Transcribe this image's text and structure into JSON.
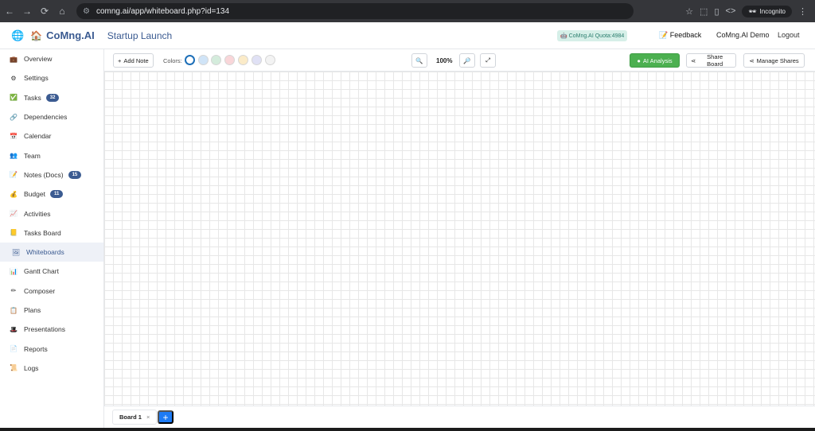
{
  "browser": {
    "url": "comng.ai/app/whiteboard.php?id=134",
    "mode_label": "Incognito"
  },
  "header": {
    "brand": "CoMng.AI",
    "project_title": "Startup Launch",
    "quota_label": "CoMng.AI Quota:4984",
    "feedback_label": "Feedback",
    "user_label": "CoMng.AI Demo",
    "logout_label": "Logout"
  },
  "sidebar": {
    "items": [
      {
        "label": "Overview",
        "icon": "briefcase-icon",
        "glyph": "💼"
      },
      {
        "label": "Settings",
        "icon": "gear-icon",
        "glyph": "⚙"
      },
      {
        "label": "Tasks",
        "icon": "checkbox-icon",
        "glyph": "✅",
        "badge": "32"
      },
      {
        "label": "Dependencies",
        "icon": "link-icon",
        "glyph": "🔗"
      },
      {
        "label": "Calendar",
        "icon": "calendar-icon",
        "glyph": "📅"
      },
      {
        "label": "Team",
        "icon": "people-icon",
        "glyph": "👥"
      },
      {
        "label": "Notes (Docs)",
        "icon": "notes-icon",
        "glyph": "📝",
        "badge": "15"
      },
      {
        "label": "Budget",
        "icon": "money-bag-icon",
        "glyph": "💰",
        "badge": "11"
      },
      {
        "label": "Activities",
        "icon": "chart-up-icon",
        "glyph": "📈"
      },
      {
        "label": "Tasks Board",
        "icon": "sticky-note-icon",
        "glyph": "📒"
      },
      {
        "label": "Whiteboards",
        "icon": "picture-icon",
        "glyph": "🖼",
        "active": true
      },
      {
        "label": "Gantt Chart",
        "icon": "bar-chart-icon",
        "glyph": "📊"
      },
      {
        "label": "Composer",
        "icon": "pencil-icon",
        "glyph": "✏"
      },
      {
        "label": "Plans",
        "icon": "clipboard-icon",
        "glyph": "📋"
      },
      {
        "label": "Presentations",
        "icon": "presentation-icon",
        "glyph": "🎩"
      },
      {
        "label": "Reports",
        "icon": "report-icon",
        "glyph": "📄"
      },
      {
        "label": "Logs",
        "icon": "scroll-icon",
        "glyph": "📜"
      }
    ]
  },
  "toolbar": {
    "add_note_label": "Add Note",
    "colors_label": "Colors:",
    "colors": [
      "#ffffff",
      "#d0e4f7",
      "#d4ecdc",
      "#f9d6d9",
      "#fbebc8",
      "#e0e1f5",
      "#f3f3f3"
    ],
    "zoom_level": "100%",
    "ai_analysis_label": "AI Analysis",
    "share_board_label": "Share Board",
    "manage_shares_label": "Manage Shares"
  },
  "boards": {
    "tabs": [
      "Board 1"
    ],
    "close_glyph": "×",
    "add_glyph": "+"
  }
}
